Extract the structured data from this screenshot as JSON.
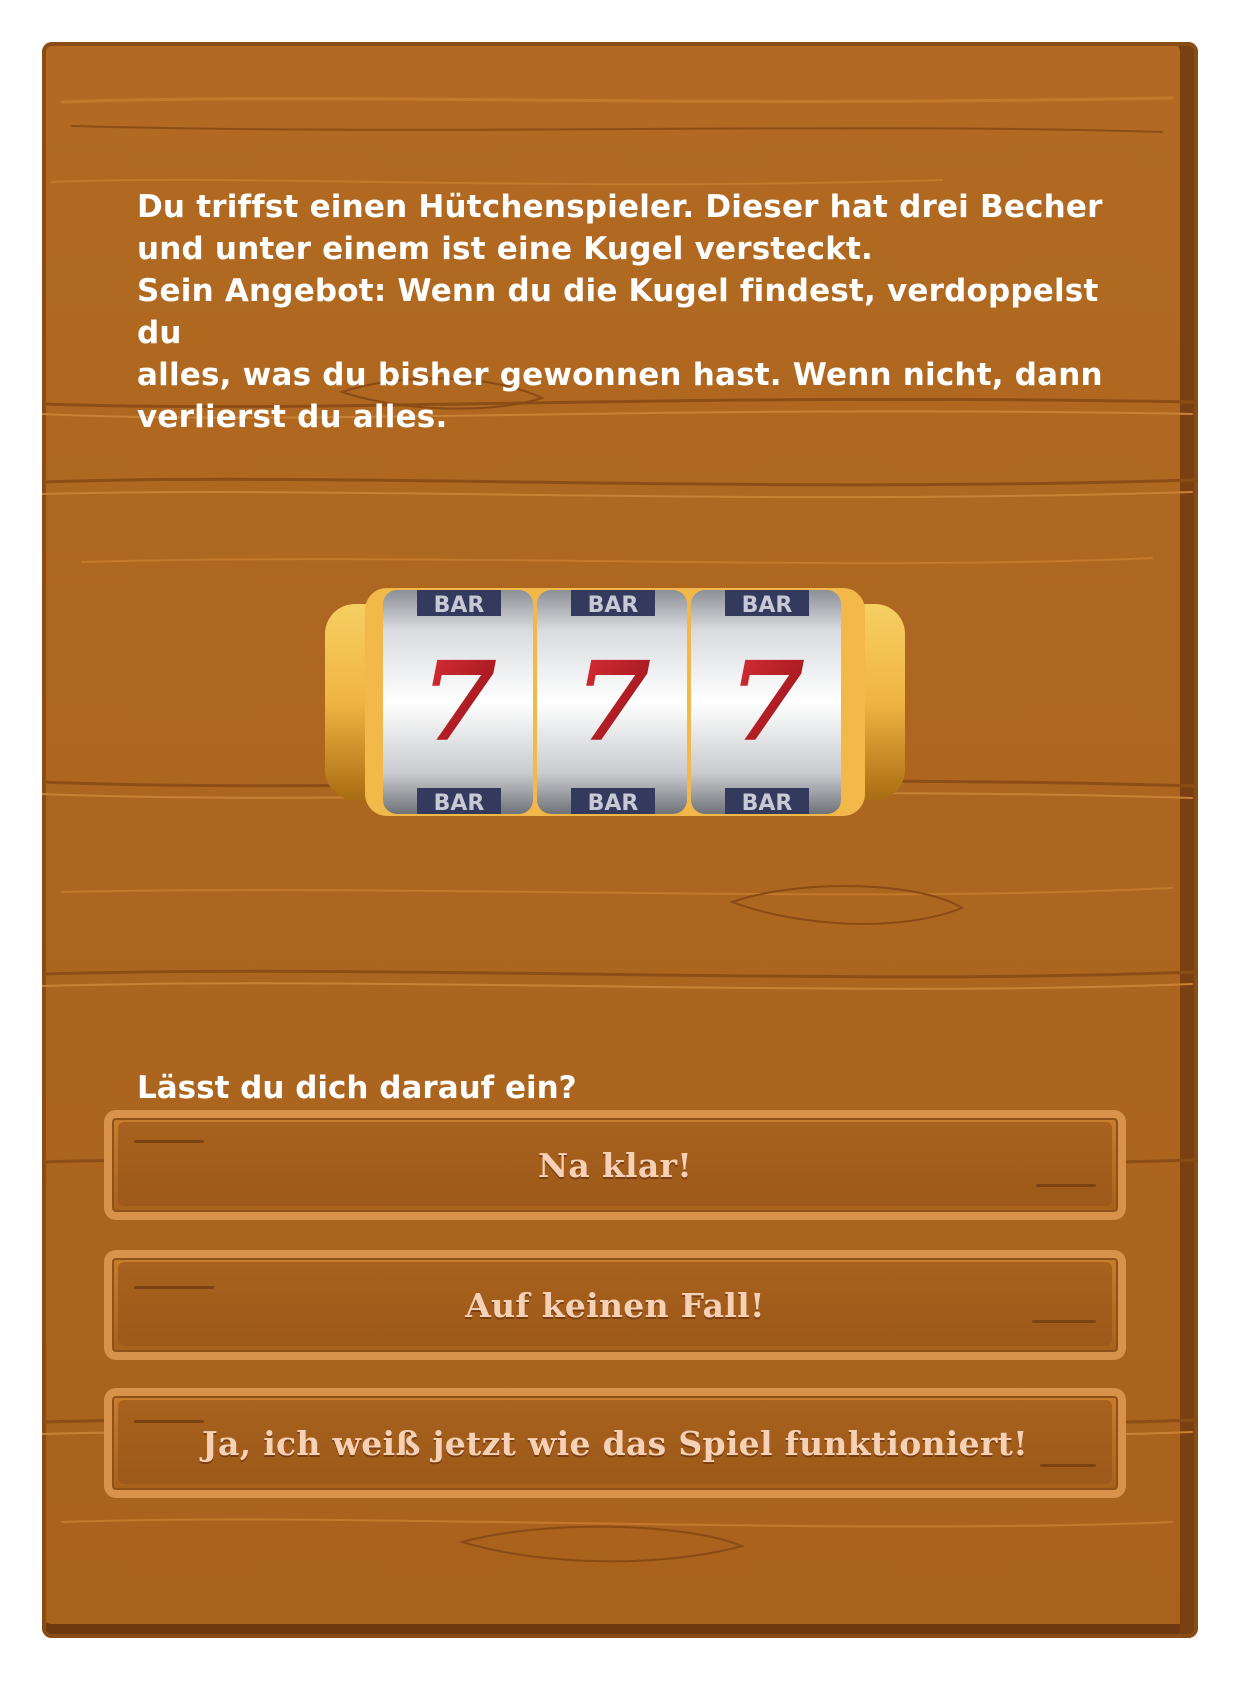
{
  "story": {
    "line1": "Du triffst einen Hütchenspieler. Dieser hat drei Becher",
    "line2": "und unter einem ist eine Kugel versteckt.",
    "line3": "Sein Angebot: Wenn du die Kugel findest, verdoppelst du",
    "line4": "alles, was du bisher gewonnen hast. Wenn nicht, dann",
    "line5": "verlierst du alles."
  },
  "slot": {
    "top_label": "BAR",
    "middle_label": "7",
    "bottom_label": "BAR"
  },
  "question": "Lässt du dich darauf ein?",
  "choices": [
    {
      "label": "Na klar!"
    },
    {
      "label": "Auf keinen Fall!"
    },
    {
      "label": "Ja, ich weiß jetzt wie das Spiel funktioniert!"
    }
  ],
  "colors": {
    "wood": "#b26a22",
    "button_text": "#f7d1b5",
    "seven_red": "#c0141e"
  }
}
